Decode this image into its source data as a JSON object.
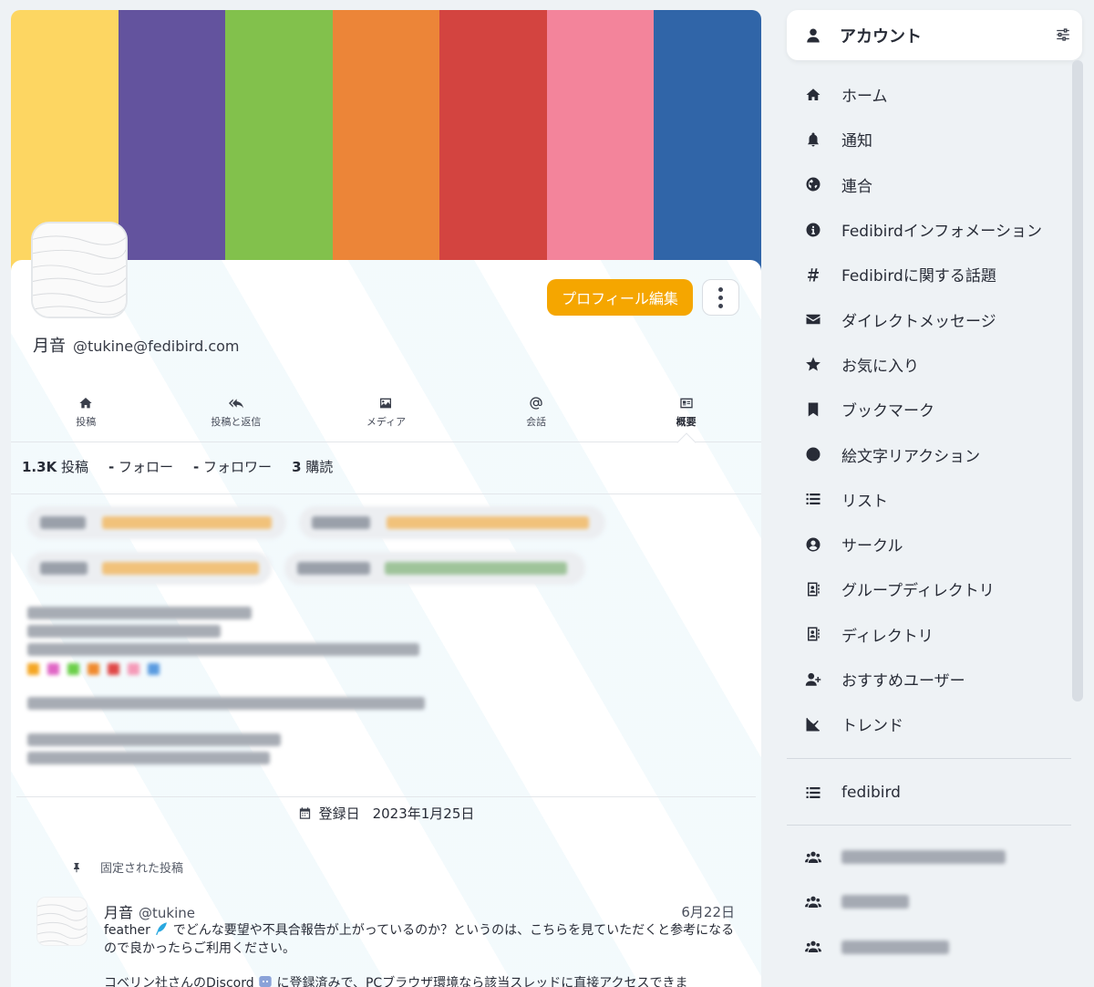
{
  "banner": {
    "colors": [
      "#fdd662",
      "#63539e",
      "#82c14c",
      "#ec8538",
      "#d34440",
      "#f3849b",
      "#3065a8"
    ]
  },
  "profile": {
    "display_name": "月音",
    "acct": "@tukine@fedibird.com",
    "edit_button": "プロフィール編集"
  },
  "tabs": [
    {
      "label": "投稿",
      "icon": "home-icon"
    },
    {
      "label": "投稿と返信",
      "icon": "reply-all-icon"
    },
    {
      "label": "メディア",
      "icon": "image-icon"
    },
    {
      "label": "会話",
      "icon": "at-icon"
    },
    {
      "label": "概要",
      "icon": "id-card-icon",
      "active": true
    }
  ],
  "counts": {
    "posts_value": "1.3K",
    "posts_label": "投稿",
    "following_value": "-",
    "following_label": "フォロー",
    "followers_value": "-",
    "followers_label": "フォロワー",
    "subscribing_value": "3",
    "subscribing_label": "購読"
  },
  "joined": {
    "label": "登録日",
    "date": "2023年1月25日"
  },
  "pinned": {
    "label": "固定された投稿"
  },
  "status": {
    "display_name": "月音",
    "acct": "@tukine",
    "date": "6月22日",
    "line1": "feather",
    "line1_rest": "でどんな要望や不具合報告が上がっているのか？というのは、こちらを見ていただくと参考になるので良かったらご利用ください。",
    "line2_start": "コベリン社さんのDiscord",
    "line2_rest": "に登録済みで、PCブラウザ環境なら該当スレッドに直接アクセスできま"
  },
  "sidebar": {
    "header": "アカウント",
    "items": [
      {
        "label": "ホーム",
        "icon": "home-icon"
      },
      {
        "label": "通知",
        "icon": "bell-icon"
      },
      {
        "label": "連合",
        "icon": "globe-icon"
      },
      {
        "label": "Fedibirdインフォメーション",
        "icon": "info-icon"
      },
      {
        "label": "Fedibirdに関する話題",
        "icon": "hashtag-icon"
      },
      {
        "label": "ダイレクトメッセージ",
        "icon": "envelope-icon"
      },
      {
        "label": "お気に入り",
        "icon": "star-icon"
      },
      {
        "label": "ブックマーク",
        "icon": "bookmark-icon"
      },
      {
        "label": "絵文字リアクション",
        "icon": "smile-icon"
      },
      {
        "label": "リスト",
        "icon": "list-icon"
      },
      {
        "label": "サークル",
        "icon": "user-circle-icon"
      },
      {
        "label": "グループディレクトリ",
        "icon": "address-book-icon"
      },
      {
        "label": "ディレクトリ",
        "icon": "address-book-icon"
      },
      {
        "label": "おすすめユーザー",
        "icon": "user-plus-icon"
      },
      {
        "label": "トレンド",
        "icon": "chart-line-icon"
      }
    ],
    "list_label": "fedibird"
  }
}
